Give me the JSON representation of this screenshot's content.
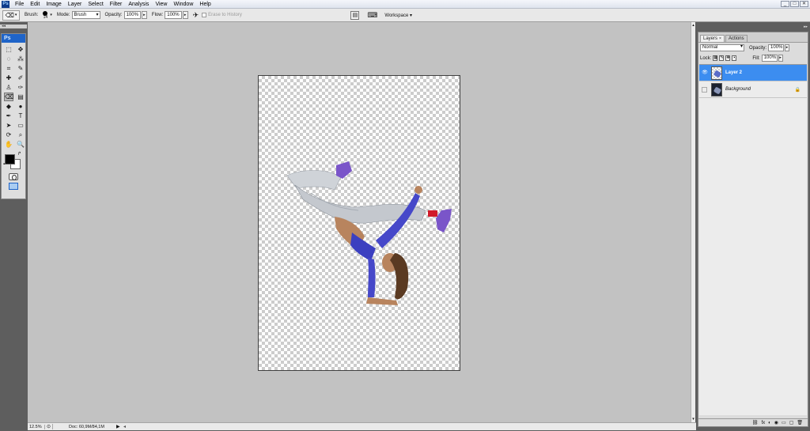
{
  "menubar": {
    "logo": "Ps",
    "items": [
      "File",
      "Edit",
      "Image",
      "Layer",
      "Select",
      "Filter",
      "Analysis",
      "View",
      "Window",
      "Help"
    ],
    "window_controls": [
      "_",
      "□",
      "✕"
    ]
  },
  "options": {
    "brush_label": "Brush:",
    "brush_size": "14",
    "mode_label": "Mode:",
    "mode_value": "Brush",
    "opacity_label": "Opacity:",
    "opacity_value": "100%",
    "flow_label": "Flow:",
    "flow_value": "100%",
    "erase_history_label": "Erase to History",
    "workspace_label": "Workspace ▾"
  },
  "tools": {
    "logo": "Ps",
    "collapse": "◂◂",
    "items": [
      {
        "name": "marquee-icon",
        "glyph": "⬚"
      },
      {
        "name": "move-icon",
        "glyph": "✥"
      },
      {
        "name": "lasso-icon",
        "glyph": "◌"
      },
      {
        "name": "magic-wand-icon",
        "glyph": "⁂"
      },
      {
        "name": "crop-icon",
        "glyph": "⌗"
      },
      {
        "name": "eyedropper-icon",
        "glyph": "✎"
      },
      {
        "name": "healing-icon",
        "glyph": "✚"
      },
      {
        "name": "brush-icon",
        "glyph": "✐"
      },
      {
        "name": "clone-stamp-icon",
        "glyph": "♙"
      },
      {
        "name": "history-brush-icon",
        "glyph": "✑"
      },
      {
        "name": "eraser-icon",
        "glyph": "⌫"
      },
      {
        "name": "gradient-icon",
        "glyph": "▤"
      },
      {
        "name": "blur-icon",
        "glyph": "◆"
      },
      {
        "name": "dodge-icon",
        "glyph": "●"
      },
      {
        "name": "pen-icon",
        "glyph": "✒"
      },
      {
        "name": "type-icon",
        "glyph": "T"
      },
      {
        "name": "path-select-icon",
        "glyph": "➤"
      },
      {
        "name": "shape-icon",
        "glyph": "▭"
      },
      {
        "name": "3d-rotate-icon",
        "glyph": "⟳"
      },
      {
        "name": "3d-camera-icon",
        "glyph": "⌕"
      },
      {
        "name": "hand-icon",
        "glyph": "✋"
      },
      {
        "name": "zoom-icon",
        "glyph": "🔍"
      }
    ],
    "active_index": 10
  },
  "status": {
    "zoom": "12.5%",
    "doc": "Doc: 60,9M/84,1M",
    "arrow": "▶",
    "scroll_left": "◂"
  },
  "layers": {
    "tabs": [
      {
        "label": "Layers",
        "close": "×",
        "active": true
      },
      {
        "label": "Actions",
        "close": "",
        "active": false
      }
    ],
    "blend_mode": "Normal",
    "opacity_label": "Opacity:",
    "opacity_value": "100%",
    "lock_label": "Lock:",
    "fill_label": "Fill:",
    "fill_value": "100%",
    "items": [
      {
        "name": "Layer 2",
        "visible": true,
        "selected": true,
        "locked": false
      },
      {
        "name": "Background",
        "visible": false,
        "selected": false,
        "locked": true
      }
    ],
    "footer_icons": [
      "⛓",
      "fx",
      "◐",
      "◉",
      "▭",
      "▢",
      "🗑"
    ]
  },
  "colors": {
    "foreground": "#000000",
    "background": "#ffffff",
    "selection": "#3c8df0",
    "workarea": "#c2c2c2"
  }
}
